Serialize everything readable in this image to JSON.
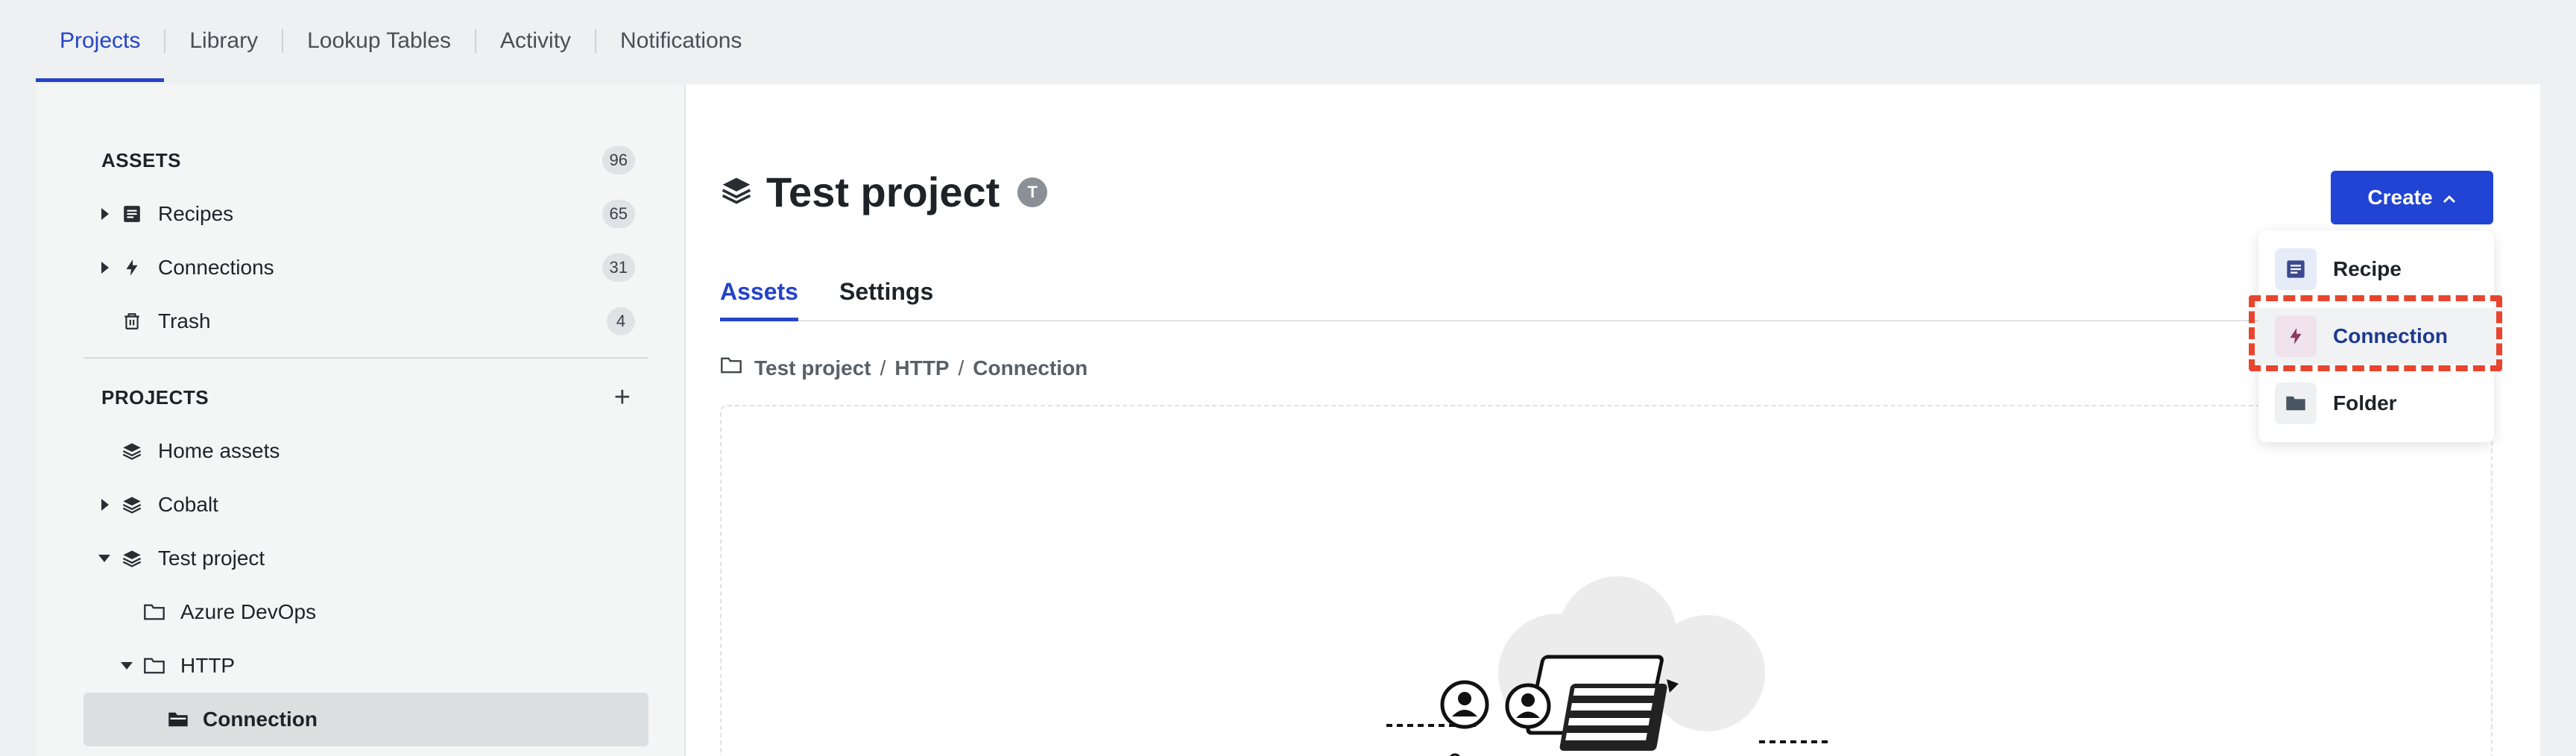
{
  "topnav": {
    "tabs": [
      {
        "label": "Projects",
        "active": true
      },
      {
        "label": "Library"
      },
      {
        "label": "Lookup Tables"
      },
      {
        "label": "Activity"
      },
      {
        "label": "Notifications"
      }
    ]
  },
  "sidebar": {
    "assets_header": "ASSETS",
    "assets_count": "96",
    "assets": [
      {
        "label": "Recipes",
        "count": "65",
        "icon": "recipe-icon"
      },
      {
        "label": "Connections",
        "count": "31",
        "icon": "bolt-icon"
      },
      {
        "label": "Trash",
        "count": "4",
        "icon": "trash-icon"
      }
    ],
    "projects_header": "PROJECTS",
    "projects": [
      {
        "label": "Home assets",
        "icon": "layers-icon"
      },
      {
        "label": "Cobalt",
        "icon": "layers-icon"
      },
      {
        "label": "Test project",
        "icon": "layers-icon"
      },
      {
        "label": "Azure DevOps",
        "icon": "folder-icon"
      },
      {
        "label": "HTTP",
        "icon": "folder-icon"
      },
      {
        "label": "Connection",
        "icon": "folder-open-icon",
        "selected": true
      }
    ]
  },
  "main": {
    "title": "Test project",
    "avatar_initial": "T",
    "tabs": [
      {
        "label": "Assets",
        "active": true
      },
      {
        "label": "Settings"
      }
    ],
    "breadcrumb": [
      "Test project",
      "HTTP",
      "Connection"
    ],
    "breadcrumb_sep": "/",
    "create_label": "Create",
    "create_menu": [
      {
        "label": "Recipe",
        "icon": "recipe-icon"
      },
      {
        "label": "Connection",
        "icon": "bolt-icon",
        "highlighted": true
      },
      {
        "label": "Folder",
        "icon": "folder-icon"
      }
    ]
  },
  "colors": {
    "accent": "#2444c8",
    "button": "#2144d4",
    "highlight": "#e8442e"
  }
}
